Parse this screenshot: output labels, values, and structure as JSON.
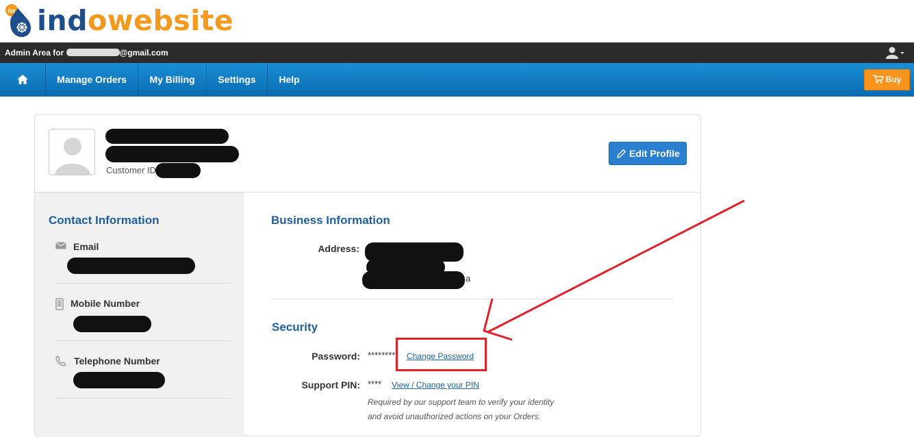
{
  "brand": {
    "logo_part1": "ind",
    "logo_part2": "o",
    "logo_part3": "website",
    "badge": "iw"
  },
  "admin_bar": {
    "prefix": "Admin Area for",
    "email_suffix": "@gmail.com",
    "user_icon": "user-icon"
  },
  "nav": {
    "home_icon": "home-icon",
    "items": [
      "Manage Orders",
      "My Billing",
      "Settings",
      "Help"
    ],
    "buy_label": "Buy",
    "buy_icon": "cart-icon"
  },
  "profile": {
    "customer_id_label": "Customer ID",
    "edit_label": "Edit Profile",
    "edit_icon": "pencil-icon"
  },
  "contact": {
    "title": "Contact Information",
    "email_label": "Email",
    "mobile_label": "Mobile Number",
    "telephone_label": "Telephone Number"
  },
  "business": {
    "title": "Business Information",
    "address_label": "Address:",
    "address_tail": "a"
  },
  "security": {
    "title": "Security",
    "password_label": "Password:",
    "password_value": "********",
    "change_password_link": "Change Password",
    "pin_label": "Support PIN:",
    "pin_value": "****",
    "pin_link": "View / Change your PIN",
    "note_line1": "Required by our support team to verify your identity",
    "note_line2": "and avoid unauthorized actions on your Orders."
  },
  "colors": {
    "nav_blue": "#0a6bb0",
    "buy_orange": "#f7941d",
    "section_blue": "#1f5fa0",
    "annotation_red": "#e0202a"
  }
}
